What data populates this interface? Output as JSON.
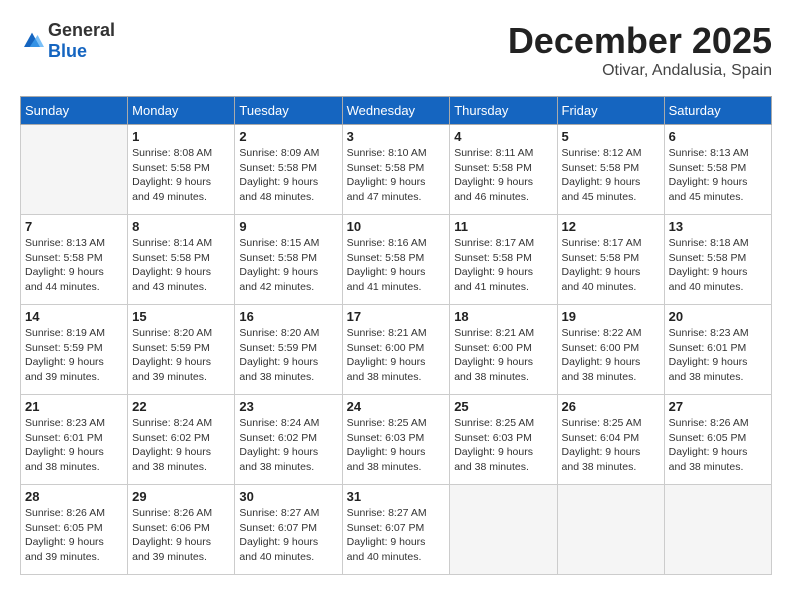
{
  "header": {
    "logo_general": "General",
    "logo_blue": "Blue",
    "month": "December 2025",
    "location": "Otivar, Andalusia, Spain"
  },
  "weekdays": [
    "Sunday",
    "Monday",
    "Tuesday",
    "Wednesday",
    "Thursday",
    "Friday",
    "Saturday"
  ],
  "weeks": [
    [
      {
        "day": "",
        "info": ""
      },
      {
        "day": "1",
        "info": "Sunrise: 8:08 AM\nSunset: 5:58 PM\nDaylight: 9 hours\nand 49 minutes."
      },
      {
        "day": "2",
        "info": "Sunrise: 8:09 AM\nSunset: 5:58 PM\nDaylight: 9 hours\nand 48 minutes."
      },
      {
        "day": "3",
        "info": "Sunrise: 8:10 AM\nSunset: 5:58 PM\nDaylight: 9 hours\nand 47 minutes."
      },
      {
        "day": "4",
        "info": "Sunrise: 8:11 AM\nSunset: 5:58 PM\nDaylight: 9 hours\nand 46 minutes."
      },
      {
        "day": "5",
        "info": "Sunrise: 8:12 AM\nSunset: 5:58 PM\nDaylight: 9 hours\nand 45 minutes."
      },
      {
        "day": "6",
        "info": "Sunrise: 8:13 AM\nSunset: 5:58 PM\nDaylight: 9 hours\nand 45 minutes."
      }
    ],
    [
      {
        "day": "7",
        "info": "Sunrise: 8:13 AM\nSunset: 5:58 PM\nDaylight: 9 hours\nand 44 minutes."
      },
      {
        "day": "8",
        "info": "Sunrise: 8:14 AM\nSunset: 5:58 PM\nDaylight: 9 hours\nand 43 minutes."
      },
      {
        "day": "9",
        "info": "Sunrise: 8:15 AM\nSunset: 5:58 PM\nDaylight: 9 hours\nand 42 minutes."
      },
      {
        "day": "10",
        "info": "Sunrise: 8:16 AM\nSunset: 5:58 PM\nDaylight: 9 hours\nand 41 minutes."
      },
      {
        "day": "11",
        "info": "Sunrise: 8:17 AM\nSunset: 5:58 PM\nDaylight: 9 hours\nand 41 minutes."
      },
      {
        "day": "12",
        "info": "Sunrise: 8:17 AM\nSunset: 5:58 PM\nDaylight: 9 hours\nand 40 minutes."
      },
      {
        "day": "13",
        "info": "Sunrise: 8:18 AM\nSunset: 5:58 PM\nDaylight: 9 hours\nand 40 minutes."
      }
    ],
    [
      {
        "day": "14",
        "info": "Sunrise: 8:19 AM\nSunset: 5:59 PM\nDaylight: 9 hours\nand 39 minutes."
      },
      {
        "day": "15",
        "info": "Sunrise: 8:20 AM\nSunset: 5:59 PM\nDaylight: 9 hours\nand 39 minutes."
      },
      {
        "day": "16",
        "info": "Sunrise: 8:20 AM\nSunset: 5:59 PM\nDaylight: 9 hours\nand 38 minutes."
      },
      {
        "day": "17",
        "info": "Sunrise: 8:21 AM\nSunset: 6:00 PM\nDaylight: 9 hours\nand 38 minutes."
      },
      {
        "day": "18",
        "info": "Sunrise: 8:21 AM\nSunset: 6:00 PM\nDaylight: 9 hours\nand 38 minutes."
      },
      {
        "day": "19",
        "info": "Sunrise: 8:22 AM\nSunset: 6:00 PM\nDaylight: 9 hours\nand 38 minutes."
      },
      {
        "day": "20",
        "info": "Sunrise: 8:23 AM\nSunset: 6:01 PM\nDaylight: 9 hours\nand 38 minutes."
      }
    ],
    [
      {
        "day": "21",
        "info": "Sunrise: 8:23 AM\nSunset: 6:01 PM\nDaylight: 9 hours\nand 38 minutes."
      },
      {
        "day": "22",
        "info": "Sunrise: 8:24 AM\nSunset: 6:02 PM\nDaylight: 9 hours\nand 38 minutes."
      },
      {
        "day": "23",
        "info": "Sunrise: 8:24 AM\nSunset: 6:02 PM\nDaylight: 9 hours\nand 38 minutes."
      },
      {
        "day": "24",
        "info": "Sunrise: 8:25 AM\nSunset: 6:03 PM\nDaylight: 9 hours\nand 38 minutes."
      },
      {
        "day": "25",
        "info": "Sunrise: 8:25 AM\nSunset: 6:03 PM\nDaylight: 9 hours\nand 38 minutes."
      },
      {
        "day": "26",
        "info": "Sunrise: 8:25 AM\nSunset: 6:04 PM\nDaylight: 9 hours\nand 38 minutes."
      },
      {
        "day": "27",
        "info": "Sunrise: 8:26 AM\nSunset: 6:05 PM\nDaylight: 9 hours\nand 38 minutes."
      }
    ],
    [
      {
        "day": "28",
        "info": "Sunrise: 8:26 AM\nSunset: 6:05 PM\nDaylight: 9 hours\nand 39 minutes."
      },
      {
        "day": "29",
        "info": "Sunrise: 8:26 AM\nSunset: 6:06 PM\nDaylight: 9 hours\nand 39 minutes."
      },
      {
        "day": "30",
        "info": "Sunrise: 8:27 AM\nSunset: 6:07 PM\nDaylight: 9 hours\nand 40 minutes."
      },
      {
        "day": "31",
        "info": "Sunrise: 8:27 AM\nSunset: 6:07 PM\nDaylight: 9 hours\nand 40 minutes."
      },
      {
        "day": "",
        "info": ""
      },
      {
        "day": "",
        "info": ""
      },
      {
        "day": "",
        "info": ""
      }
    ]
  ]
}
